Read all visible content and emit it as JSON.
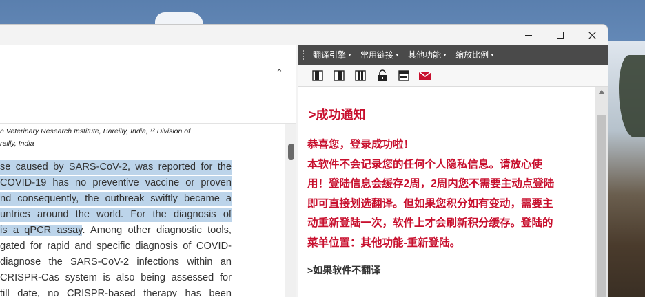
{
  "window": {
    "controls": {
      "minimize": "minimize",
      "maximize": "maximize",
      "close": "close"
    }
  },
  "document": {
    "affiliation_lines": [
      "n Veterinary Research Institute, Bareilly, India, ¹² Division of",
      "reilly, India"
    ],
    "abstract_lines": [
      {
        "text": "se caused by SARS-CoV-2, was reported for the",
        "highlighted": true
      },
      {
        "text": "COVID-19 has no preventive vaccine or proven",
        "highlighted": true
      },
      {
        "text": "nd consequently, the outbreak swiftly became a",
        "highlighted": true
      },
      {
        "text": "untries around the world. For the diagnosis of",
        "highlighted": true
      },
      {
        "text": "is a qPCR assay. Among other diagnostic tools,",
        "highlighted_prefix": "is a qPCR assay",
        "rest": ". Among other diagnostic tools,"
      },
      {
        "text": "gated for rapid and specific diagnosis of COVID-",
        "highlighted": false
      },
      {
        "text": "diagnose the SARS-CoV-2 infections within an",
        "highlighted": false
      },
      {
        "text": "CRISPR-Cas system is also being assessed for",
        "highlighted": false
      },
      {
        "text": "till date, no CRISPR-based therapy has been",
        "highlighted": false
      }
    ],
    "highlight_color": "#bcd4ea"
  },
  "translator": {
    "menu": [
      {
        "label": "翻译引擎"
      },
      {
        "label": "常用链接"
      },
      {
        "label": "其他功能"
      },
      {
        "label": "缩放比例"
      }
    ],
    "toolbar_icons": [
      "book-icon",
      "book-icon",
      "book-icon",
      "unlock-icon",
      "window-icon",
      "mail-icon"
    ],
    "heading": ">成功通知",
    "message_lines": [
      "恭喜您，登录成功啦！",
      "本软件不会记录您的任何个人隐私信息。请放心使",
      "用！登陆信息会缓存2周，2周内您不需要主动点登陆",
      "即可直接划选翻译。但如果您积分如有变动，需要主",
      "动重新登陆一次，软件上才会刷新积分缓存。登陆的",
      "菜单位置：其他功能-重新登陆。"
    ],
    "subheading": ">如果软件不翻译",
    "accent_color": "#c8102e"
  }
}
